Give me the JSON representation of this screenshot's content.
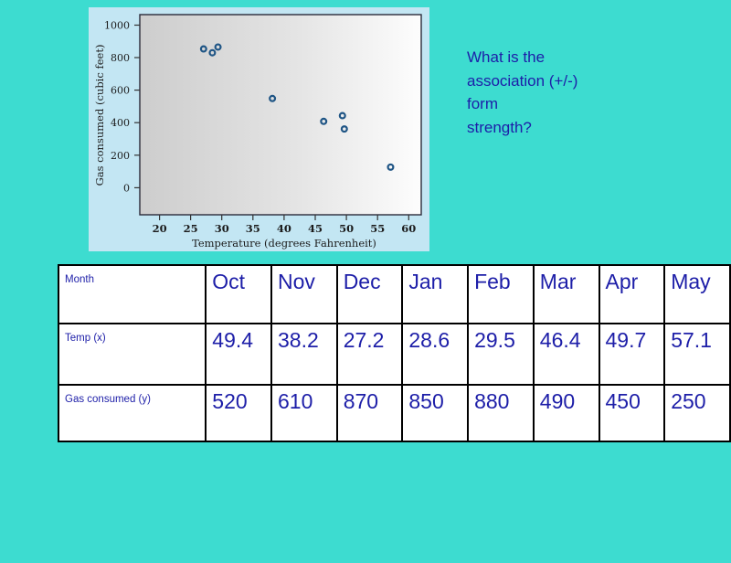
{
  "background_color": "#3ddcd0",
  "accent_text_color": "#1d1ea8",
  "question": {
    "line1": "What is the",
    "line2": "association (+/-)",
    "line3": "form",
    "line4": "strength?",
    "full": "What is the association (+/-) form strength?"
  },
  "figure": {
    "panel_background": "#c3e6f3",
    "plot_fill_left": "#cfcfcf",
    "plot_fill_right": "#fcfcfc",
    "marker_color": "#1f5585",
    "axis_color": "#333333"
  },
  "chart_data": {
    "type": "scatter",
    "title": "",
    "xlabel": "Temperature (degrees Fahrenheit)",
    "ylabel": "Gas consumed (cubic feet)",
    "xlim": [
      17,
      62
    ],
    "ylim": [
      0,
      1050
    ],
    "xticks": [
      20,
      25,
      30,
      35,
      40,
      45,
      50,
      55,
      60
    ],
    "yticks": [
      0,
      200,
      400,
      600,
      800,
      1000
    ],
    "grid": false,
    "legend": "none",
    "series": [
      {
        "name": "Gas consumed vs Temperature",
        "points": [
          {
            "month": "Oct",
            "x": 49.4,
            "y": 520
          },
          {
            "month": "Nov",
            "x": 38.2,
            "y": 610
          },
          {
            "month": "Dec",
            "x": 27.2,
            "y": 870
          },
          {
            "month": "Jan",
            "x": 28.6,
            "y": 850
          },
          {
            "month": "Feb",
            "x": 29.5,
            "y": 880
          },
          {
            "month": "Mar",
            "x": 46.4,
            "y": 490
          },
          {
            "month": "Apr",
            "x": 49.7,
            "y": 450
          },
          {
            "month": "May",
            "x": 57.1,
            "y": 250
          }
        ]
      }
    ]
  },
  "table": {
    "rows": [
      {
        "label": "Month",
        "values": [
          "Oct",
          "Nov",
          "Dec",
          "Jan",
          "Feb",
          "Mar",
          "Apr",
          "May"
        ]
      },
      {
        "label": "Temp (x)",
        "values": [
          "49.4",
          "38.2",
          "27.2",
          "28.6",
          "29.5",
          "46.4",
          "49.7",
          "57.1"
        ]
      },
      {
        "label": "Gas consumed (y)",
        "values": [
          "520",
          "610",
          "870",
          "850",
          "880",
          "490",
          "450",
          "250"
        ]
      }
    ]
  }
}
